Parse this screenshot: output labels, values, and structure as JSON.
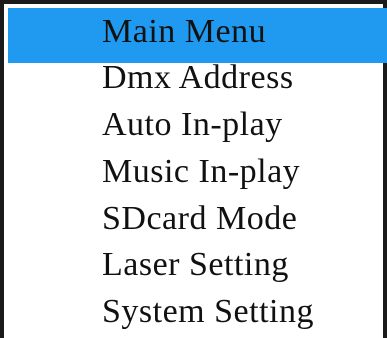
{
  "menu": {
    "title": "Main Menu",
    "items": [
      "Dmx Address",
      "Auto In-play",
      "Music In-play",
      "SDcard Mode",
      "Laser Setting",
      "System Setting"
    ],
    "highlight_color": "#1f9af0"
  }
}
